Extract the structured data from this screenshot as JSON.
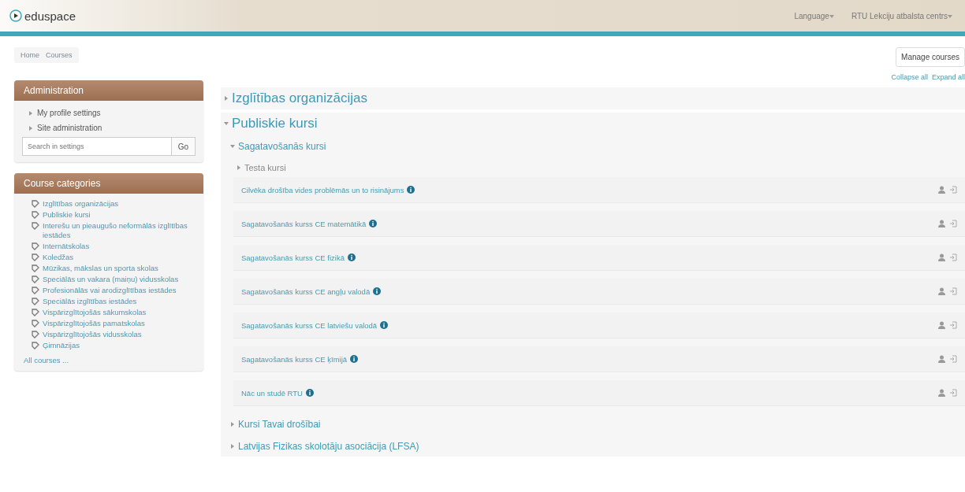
{
  "header": {
    "logo": "eduspace",
    "language": "Language",
    "user": "RTU Lekciju atbalsta centrs"
  },
  "breadcrumb": [
    "Home",
    "Courses"
  ],
  "manage_button": "Manage courses",
  "collapse_links": [
    "Collapse all",
    "Expand all"
  ],
  "administration": {
    "title": "Administration",
    "items": [
      "My profile settings",
      "Site administration"
    ],
    "search": {
      "placeholder": "Search in settings",
      "button": "Go"
    }
  },
  "course_categories": {
    "title": "Course categories",
    "items": [
      "Izglītības organizācijas",
      "Publiskie kursi",
      "Interešu un pieaugušo neformālās izglītības iestādes",
      "Internātskolas",
      "Koledžas",
      "Mūzikas, mākslas un sporta skolas",
      "Speciālās un vakara (maiņu) vidusskolas",
      "Profesionālās vai arodizglītības iestādes",
      "Speciālās izglītības iestādes",
      "Vispārizglītojošās sākumskolas",
      "Vispārizglītojošās pamatskolas",
      "Vispārizglītojošās vidusskolas",
      "Ģimnāzijas"
    ],
    "all_link": "All courses ..."
  },
  "categories": [
    {
      "name": "Izglītības organizācijas",
      "expanded": false
    },
    {
      "name": "Publiskie kursi",
      "expanded": true,
      "children": [
        {
          "name": "Sagatavošanās kursi",
          "expanded": true,
          "children": [
            {
              "name": "Testa kursi",
              "expanded": false
            }
          ],
          "courses": [
            "Cilvēka drošība vides problēmās un to risinājums",
            "Sagatavošanās kurss CE matemātikā",
            "Sagatavošanās kurss CE fizikā",
            "Sagatavošanās kurss CE angļu valodā",
            "Sagatavošanās kurss CE latviešu valodā",
            "Sagatavošanās kurss CE ķīmijā",
            "Nāc un studē RTU"
          ]
        },
        {
          "name": "Kursi Tavai drošībai",
          "expanded": false
        },
        {
          "name": "Latvijas Fizikas skolotāju asociācija (LFSA)",
          "expanded": false
        }
      ]
    }
  ]
}
